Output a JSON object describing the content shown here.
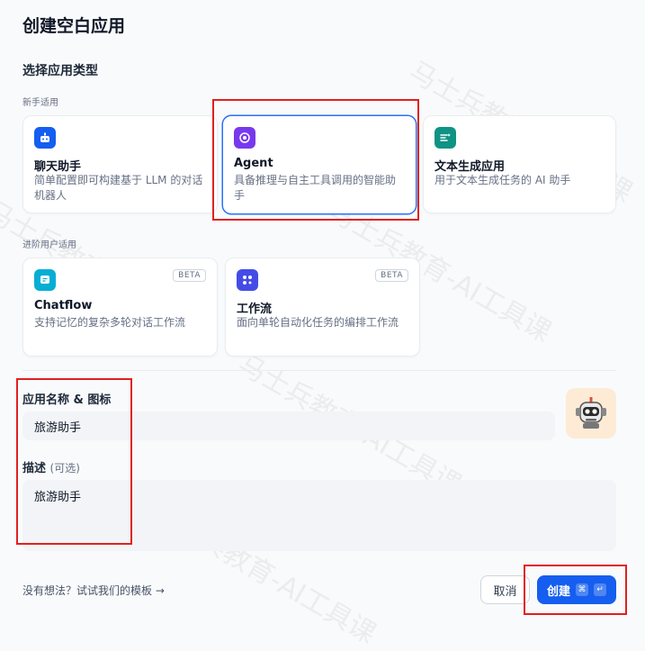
{
  "dialog": {
    "title": "创建空白应用"
  },
  "app_type": {
    "section_title": "选择应用类型",
    "beginner_label": "新手适用",
    "advanced_label": "进阶用户适用",
    "beginner_cards": [
      {
        "name": "聊天助手",
        "desc": "简单配置即可构建基于 LLM 的对话机器人",
        "icon": "chat-bot-icon",
        "color": "#155eef",
        "selected": false
      },
      {
        "name": "Agent",
        "desc": "具备推理与自主工具调用的智能助手",
        "icon": "agent-icon",
        "color": "#7839ee",
        "selected": true
      },
      {
        "name": "文本生成应用",
        "desc": "用于文本生成任务的 AI 助手",
        "icon": "text-generator-icon",
        "color": "#0e9384",
        "selected": false
      }
    ],
    "advanced_cards": [
      {
        "name": "Chatflow",
        "desc": "支持记忆的复杂多轮对话工作流",
        "icon": "chatflow-icon",
        "color": "#06aed4",
        "badge": "BETA"
      },
      {
        "name": "工作流",
        "desc": "面向单轮自动化任务的编排工作流",
        "icon": "workflow-icon",
        "color": "#444ce7",
        "badge": "BETA"
      }
    ]
  },
  "form": {
    "name_label": "应用名称 & 图标",
    "name_value": "旅游助手",
    "desc_label": "描述",
    "desc_optional": "(可选)",
    "desc_value": "旅游助手",
    "avatar_icon": "robot-avatar-icon"
  },
  "footer": {
    "template_link": "没有想法？试试我们的模板 →",
    "cancel_label": "取消",
    "create_label": "创建",
    "shortcut_keys": [
      "⌘",
      "↵"
    ]
  },
  "watermark": "马士兵教育-AI工具课",
  "colors": {
    "primary": "#155eef",
    "selected_border": "#2970ff",
    "annotation_red": "#e02020"
  }
}
